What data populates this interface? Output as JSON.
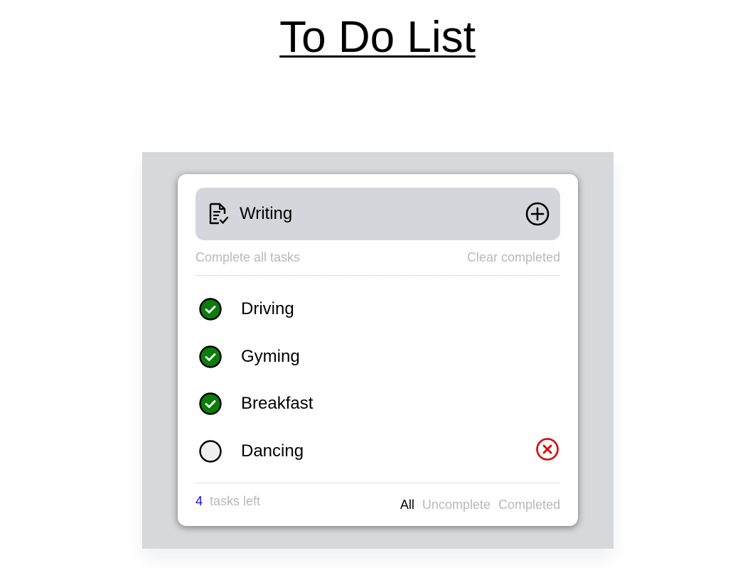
{
  "page": {
    "title": "To Do List"
  },
  "input": {
    "value": "Writing",
    "icon": "document-check-icon",
    "add_icon": "plus-circle-icon"
  },
  "actions": {
    "complete_all": "Complete all tasks",
    "clear_completed": "Clear completed"
  },
  "tasks": [
    {
      "label": "Driving",
      "completed": true
    },
    {
      "label": "Gyming",
      "completed": true
    },
    {
      "label": "Breakfast",
      "completed": true
    },
    {
      "label": "Dancing",
      "completed": false
    }
  ],
  "footer": {
    "count": "4",
    "count_label": "tasks left",
    "filters": [
      "All",
      "Uncomplete",
      "Completed"
    ],
    "active_filter": "All"
  },
  "colors": {
    "completed_check": "#0a7d0a",
    "delete": "#e00000",
    "count": "#1010d8",
    "muted_text": "#b8b8b8",
    "backdrop": "#d6d8dc",
    "input_bg": "#d4d6db"
  }
}
